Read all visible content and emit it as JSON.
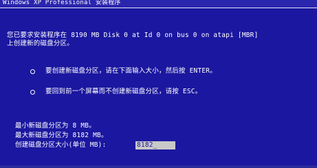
{
  "window": {
    "title": "Windows XP Professional 安装程序"
  },
  "intro": {
    "line1": "您已要求安装程序在 8190 MB Disk 0 at Id 0 on bus 0 on atapi [MBR]",
    "line2": "上创建新的磁盘分区。"
  },
  "options": [
    {
      "text": "要创建新磁盘分区，请在下面输入大小，然后按 ENTER。"
    },
    {
      "text": "要回到前一个屏幕而不创建新磁盘分区，请按 ESC。"
    }
  ],
  "sizes": {
    "min_line": "最小新磁盘分区为      8 MB。",
    "max_line": "最大新磁盘分区为   8182 MB。",
    "input_label": "创建磁盘分区大小(单位 MB):",
    "input_value": "8182_"
  },
  "colors": {
    "background": "#1b17a0",
    "text": "#ffffff",
    "input_background": "#c8c8c8"
  }
}
